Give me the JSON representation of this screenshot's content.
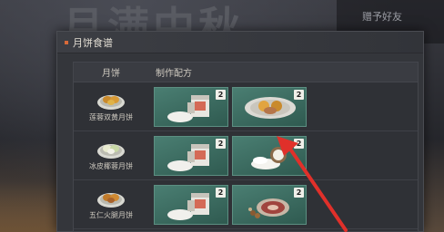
{
  "background": {
    "title": "月满中秋",
    "side_item": "赠予好友"
  },
  "panel": {
    "title": "月饼食谱",
    "columns": {
      "mooncake": "月饼",
      "recipe": "制作配方"
    }
  },
  "rows": [
    {
      "name": "莲蓉双黄月饼",
      "ingredients": [
        {
          "count": "2"
        },
        {
          "count": "2"
        }
      ]
    },
    {
      "name": "冰皮椰蓉月饼",
      "ingredients": [
        {
          "count": "2"
        },
        {
          "count": "2"
        }
      ]
    },
    {
      "name": "五仁火腿月饼",
      "ingredients": [
        {
          "count": "2"
        },
        {
          "count": "2"
        }
      ]
    }
  ],
  "colors": {
    "slot": "#3f7065",
    "arrow": "#e0302a",
    "accent": "#d86a3a"
  }
}
